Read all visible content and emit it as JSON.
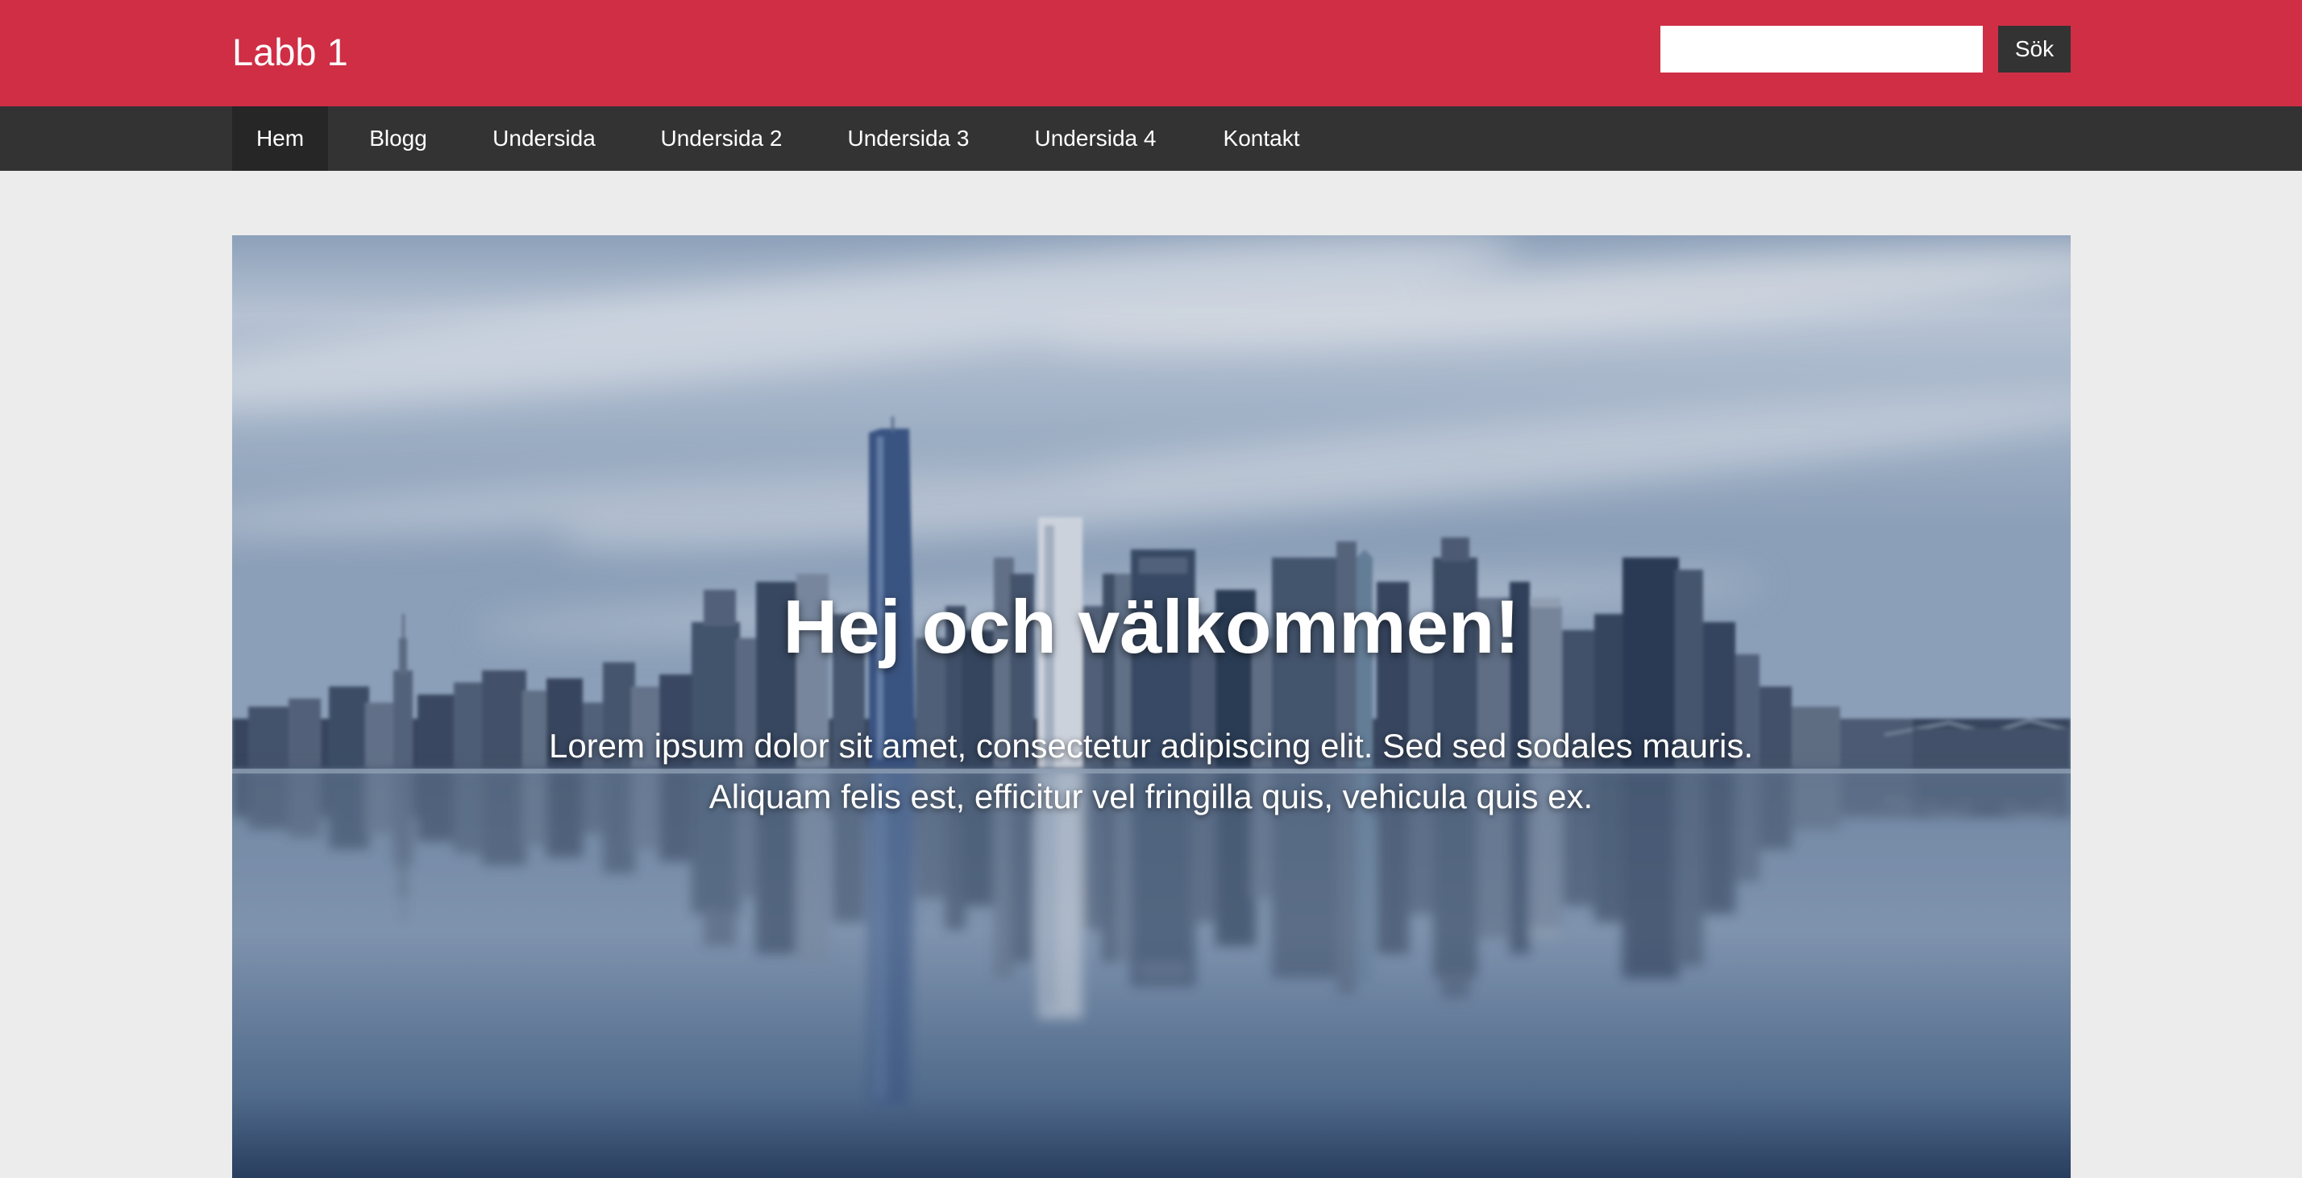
{
  "header": {
    "brand": "Labb 1",
    "search": {
      "value": "",
      "placeholder": ""
    },
    "search_button_label": "Sök"
  },
  "nav": {
    "items": [
      {
        "label": "Hem",
        "active": true
      },
      {
        "label": "Blogg"
      },
      {
        "label": "Undersida"
      },
      {
        "label": "Undersida 2"
      },
      {
        "label": "Undersida 3"
      },
      {
        "label": "Undersida 4"
      },
      {
        "label": "Kontakt"
      }
    ]
  },
  "hero": {
    "title": "Hej och välkommen!",
    "text": "Lorem ipsum dolor sit amet, consectetur adipiscing elit. Sed sed sodales mauris. Aliquam felis est, efficitur vel fringilla quis, vehicula quis ex.",
    "image": "city-skyline-reflection"
  },
  "colors": {
    "brand_red": "#cf2e45",
    "nav_dark": "#333333",
    "nav_active": "#262626",
    "page_background": "#ececec"
  }
}
